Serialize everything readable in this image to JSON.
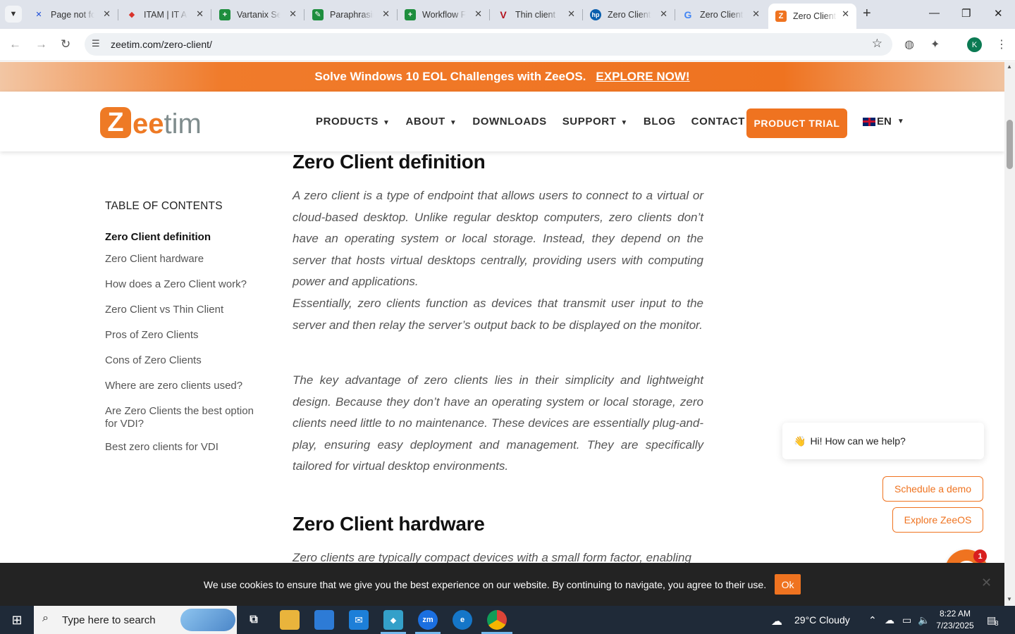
{
  "browser": {
    "tabs": [
      {
        "title": "Page not fo",
        "icon": "x-logo-icon",
        "color": "#1d4ed8"
      },
      {
        "title": "ITAM | IT A",
        "icon": "diamond-logo-icon",
        "color": "#d9332c"
      },
      {
        "title": "Vartanix Se",
        "icon": "sheets-icon",
        "color": "#1e8e3e"
      },
      {
        "title": "Paraphrasin",
        "icon": "sheets-edit-icon",
        "color": "#1e8e3e"
      },
      {
        "title": "Workflow F",
        "icon": "sheets-icon",
        "color": "#1e8e3e"
      },
      {
        "title": "Thin client",
        "icon": "v-logo-icon",
        "color": "#b3121d"
      },
      {
        "title": "Zero Client",
        "icon": "hp-logo-icon",
        "color": "#0a5fae"
      },
      {
        "title": "Zero Client",
        "icon": "google-icon",
        "color": "#4285f4"
      },
      {
        "title": "Zero Client",
        "icon": "zeetim-icon",
        "color": "#ef7320"
      }
    ],
    "url": "zeetim.com/zero-client/",
    "profile_initial": "K"
  },
  "promo": {
    "text": "Solve Windows 10 EOL Challenges with ZeeOS.",
    "link": "EXPLORE NOW!"
  },
  "header": {
    "logo_z": "Z",
    "logo_ee": "ee",
    "logo_tim": "tim",
    "nav": [
      {
        "label": "PRODUCTS",
        "dropdown": true
      },
      {
        "label": "ABOUT",
        "dropdown": true
      },
      {
        "label": "DOWNLOADS",
        "dropdown": false
      },
      {
        "label": "SUPPORT",
        "dropdown": true
      },
      {
        "label": "BLOG",
        "dropdown": false
      },
      {
        "label": "CONTACT",
        "dropdown": false
      }
    ],
    "cta": "PRODUCT TRIAL",
    "lang": "EN"
  },
  "toc": {
    "title": "TABLE OF CONTENTS",
    "items": [
      "Zero Client definition",
      "Zero Client hardware",
      "How does a Zero Client work?",
      "Zero Client vs Thin Client",
      "Pros of Zero Clients",
      "Cons of Zero Clients",
      "Where are zero clients used?",
      "Are Zero Clients the best option for VDI?",
      "Best zero clients for VDI"
    ]
  },
  "content": {
    "h1": "Zero Client definition",
    "p1": "A zero client is a type of endpoint that allows users to connect to a virtual or cloud-based desktop. Unlike regular desktop computers, zero clients don’t have an operating system or local storage. Instead, they depend on the server that hosts virtual desktops centrally, providing users with computing power and applications.",
    "p2": "Essentially, zero clients function as devices that transmit user input to the server and then relay the server’s output back to be displayed on the monitor.",
    "p3": "The key advantage of zero clients lies in their simplicity and lightweight design. Because they don’t have an operating system or local storage, zero clients need little to no maintenance. These devices are essentially plug-and-play, ensuring easy deployment and management. They are specifically tailored for virtual desktop environments.",
    "h2": "Zero Client hardware",
    "p4": "Zero clients are typically compact devices with a small form factor, enabling"
  },
  "chat": {
    "greeting": "Hi! How can we help?",
    "schedule": "Schedule a demo",
    "explore": "Explore ZeeOS",
    "badge": "1"
  },
  "cookie": {
    "text": "We use cookies to ensure that we give you the best experience on our website. By continuing to navigate, you agree to their use.",
    "ok": "Ok"
  },
  "taskbar": {
    "search_placeholder": "Type here to search",
    "weather": "29°C  Cloudy",
    "time": "8:22 AM",
    "date": "7/23/2025",
    "notifications": "8"
  }
}
